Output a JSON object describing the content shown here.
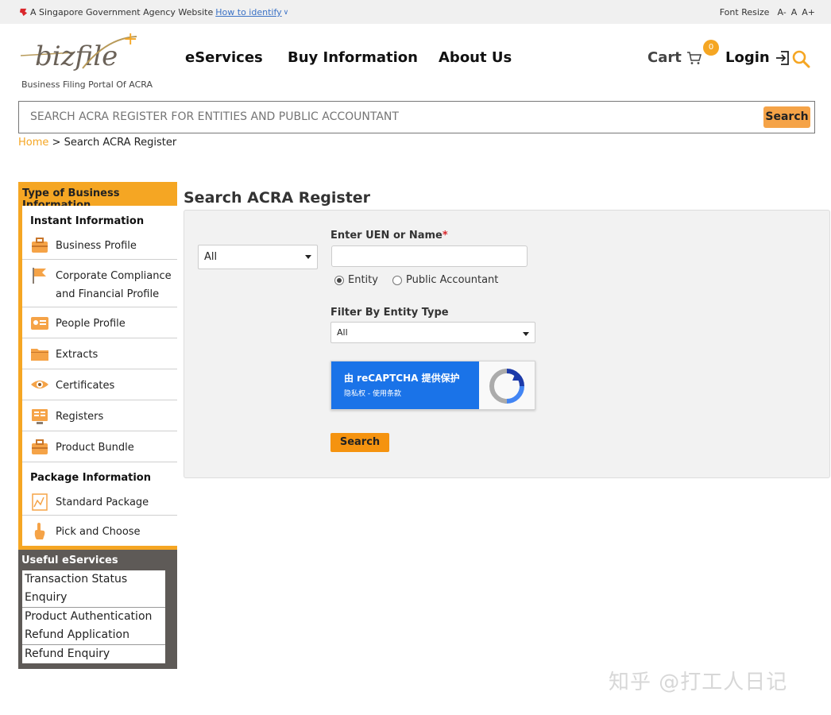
{
  "gov_banner": {
    "text": "A Singapore Government Agency Website",
    "link": "How to identify",
    "font_resize_label": "Font Resize",
    "font_sizes": [
      "A-",
      "A",
      "A+"
    ]
  },
  "header": {
    "logo_text": "bizfile",
    "logo_plus": "+",
    "logo_subtitle": "Business Filing Portal Of ACRA",
    "nav": [
      "eServices",
      "Buy Information",
      "About Us"
    ],
    "cart_label": "Cart",
    "cart_count": "0",
    "login_label": "Login"
  },
  "search_bar": {
    "placeholder": "SEARCH ACRA REGISTER FOR ENTITIES AND PUBLIC ACCOUNTANT",
    "button": "Search"
  },
  "breadcrumb": {
    "home": "Home",
    "separator": ">",
    "current": "Search ACRA Register"
  },
  "sidebar": {
    "title": "Type of Business Information",
    "instant_heading": "Instant Information",
    "instant_items": [
      {
        "label": "Business Profile",
        "icon": "briefcase-icon"
      },
      {
        "label": "Corporate Compliance",
        "label2": "and Financial Profile",
        "icon": "flag-icon"
      },
      {
        "label": "People Profile",
        "icon": "id-card-icon"
      },
      {
        "label": "Extracts",
        "icon": "folder-icon"
      },
      {
        "label": "Certificates",
        "icon": "eye-icon"
      },
      {
        "label": "Registers",
        "icon": "register-icon"
      },
      {
        "label": "Product Bundle",
        "icon": "bundle-icon"
      }
    ],
    "package_heading": "Package Information",
    "package_items": [
      {
        "label": "Standard Package",
        "icon": "package-icon"
      },
      {
        "label": "Pick and Choose",
        "icon": "pointer-icon"
      }
    ]
  },
  "useful": {
    "title": "Useful eServices",
    "items": [
      "Transaction Status",
      "Enquiry",
      "Product Authentication",
      "Refund Application",
      "Refund Enquiry"
    ]
  },
  "main": {
    "title": "Search ACRA Register",
    "scope_select": "All",
    "uen_label": "Enter UEN or Name",
    "required_mark": "*",
    "uen_value": "",
    "radio_entity": "Entity",
    "radio_pa": "Public Accountant",
    "filter_label": "Filter By Entity Type",
    "filter_select": "All",
    "recaptcha_main": "由 reCAPTCHA 提供保护",
    "recaptcha_sub": "隐私权 - 使用条款",
    "search_button": "Search"
  },
  "watermark": "知乎 @打工人日记",
  "colors": {
    "accent": "#f5a623",
    "button": "#f5930f",
    "sidebar_dark": "#5e5a57",
    "recaptcha_blue": "#1a73e8"
  }
}
